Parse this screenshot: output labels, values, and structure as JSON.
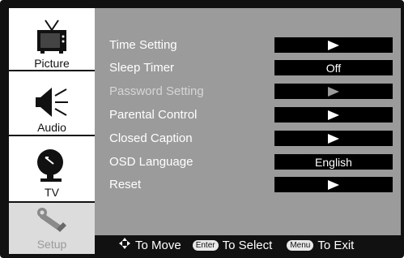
{
  "sidebar": {
    "tabs": [
      {
        "label": "Picture",
        "icon": "tv-icon"
      },
      {
        "label": "Audio",
        "icon": "speaker-icon"
      },
      {
        "label": "TV",
        "icon": "satellite-dish-icon"
      },
      {
        "label": "Setup",
        "icon": "tools-icon"
      }
    ]
  },
  "menu": {
    "items": [
      {
        "label": "Time Setting",
        "value": ""
      },
      {
        "label": "Sleep Timer",
        "value": "Off"
      },
      {
        "label": "Password Setting",
        "value": ""
      },
      {
        "label": "Parental Control",
        "value": ""
      },
      {
        "label": "Closed Caption",
        "value": ""
      },
      {
        "label": "OSD Language",
        "value": "English"
      },
      {
        "label": "Reset",
        "value": ""
      }
    ]
  },
  "footer": {
    "move_text": "To Move",
    "enter_key": "Enter",
    "select_text": "To Select",
    "menu_key": "Menu",
    "exit_text": "To Exit"
  },
  "colors": {
    "panel": "#9b9b9b",
    "value_box": "#000000",
    "sidebar": "#ffffff"
  }
}
